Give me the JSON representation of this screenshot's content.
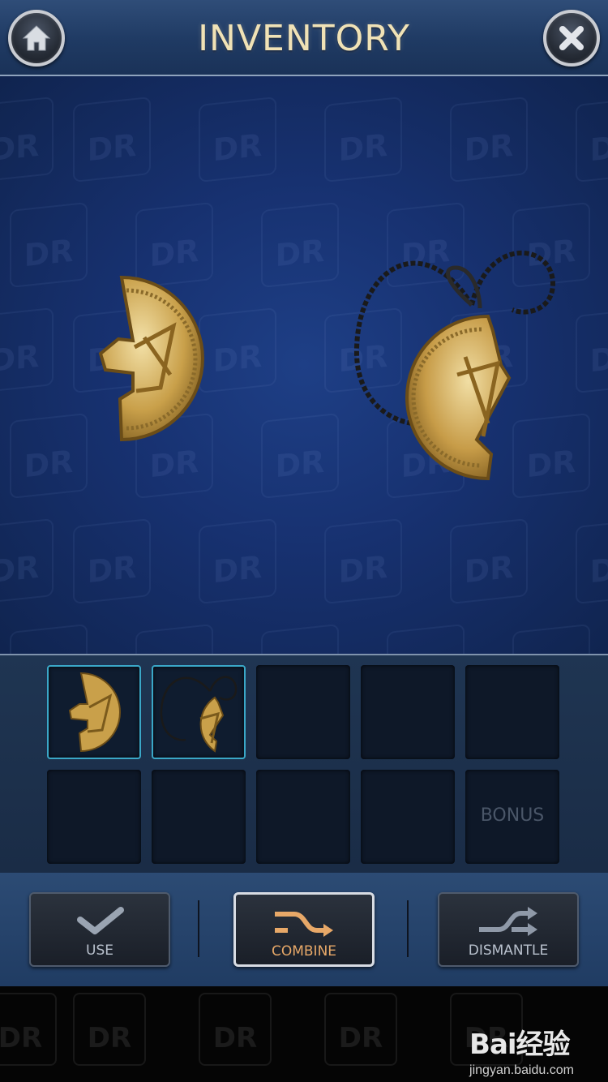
{
  "header": {
    "title": "INVENTORY",
    "home_icon": "home-icon",
    "close_icon": "close-icon"
  },
  "viewer": {
    "watermark": "DR",
    "items": [
      "half-amulet-icon",
      "amulet-necklace-icon"
    ]
  },
  "slots": {
    "row1": [
      {
        "icon": "half-amulet-icon",
        "filled": true
      },
      {
        "icon": "amulet-necklace-icon",
        "filled": true
      },
      {
        "filled": false
      },
      {
        "filled": false
      },
      {
        "filled": false
      }
    ],
    "row2": [
      {
        "filled": false
      },
      {
        "filled": false
      },
      {
        "filled": false
      },
      {
        "filled": false
      },
      {
        "label": "BONUS",
        "filled": false
      }
    ]
  },
  "actions": {
    "use_label": "USE",
    "combine_label": "COMBINE",
    "dismantle_label": "DISMANTLE",
    "active": "combine"
  },
  "watermark_brand": {
    "brand": "Bai经验",
    "sub": "jingyan.baidu.com"
  },
  "colors": {
    "accent_gold": "#d9b45a",
    "slot_highlight": "#3aa7c7",
    "combine_text": "#e7a868"
  }
}
